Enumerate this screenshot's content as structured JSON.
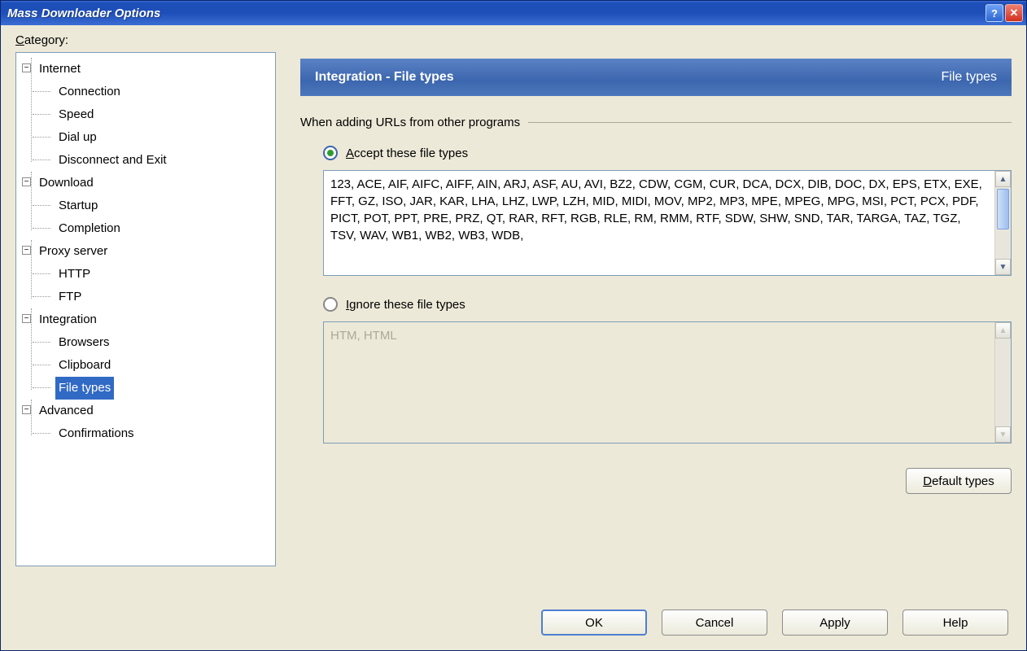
{
  "titlebar": {
    "title": "Mass Downloader Options"
  },
  "category_label": "Category:",
  "tree": {
    "internet": {
      "label": "Internet",
      "children": [
        "Connection",
        "Speed",
        "Dial up",
        "Disconnect and Exit"
      ]
    },
    "download": {
      "label": "Download",
      "children": [
        "Startup",
        "Completion"
      ]
    },
    "proxy": {
      "label": "Proxy server",
      "children": [
        "HTTP",
        "FTP"
      ]
    },
    "integration": {
      "label": "Integration",
      "children": [
        "Browsers",
        "Clipboard",
        "File types"
      ],
      "selected_index": 2
    },
    "advanced": {
      "label": "Advanced",
      "children": [
        "Confirmations"
      ]
    }
  },
  "header": {
    "left": "Integration - File types",
    "right": "File types"
  },
  "fieldset_label": "When adding URLs from other programs",
  "accept": {
    "radio_label": "Accept these file types",
    "value": "123, ACE, AIF, AIFC, AIFF, AIN, ARJ, ASF, AU, AVI, BZ2, CDW, CGM, CUR, DCA, DCX, DIB, DOC, DX, EPS, ETX, EXE, FFT, GZ, ISO, JAR, KAR, LHA, LHZ, LWP, LZH, MID, MIDI, MOV, MP2, MP3, MPE, MPEG, MPG, MSI, PCT, PCX, PDF, PICT, POT, PPT, PRE, PRZ, QT, RAR, RFT, RGB, RLE, RM, RMM, RTF, SDW, SHW, SND, TAR, TARGA, TAZ, TGZ, TSV, WAV, WB1, WB2, WB3, WDB,"
  },
  "ignore": {
    "radio_label": "Ignore these file types",
    "value": "HTM, HTML"
  },
  "buttons": {
    "default_types": "Default types",
    "ok": "OK",
    "cancel": "Cancel",
    "apply": "Apply",
    "help": "Help"
  }
}
